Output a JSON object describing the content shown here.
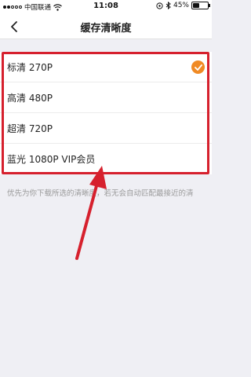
{
  "status_bar": {
    "carrier": "中国联通",
    "time": "11:08",
    "battery_text": "45%",
    "battery_level": 0.45
  },
  "nav": {
    "title": "缓存清晰度",
    "back_icon": "chevron-left-icon"
  },
  "options": [
    {
      "label": "标清 270P",
      "selected": true
    },
    {
      "label": "高清 480P",
      "selected": false
    },
    {
      "label": "超清 720P",
      "selected": false
    },
    {
      "label": "蓝光 1080P VIP会员",
      "selected": false
    }
  ],
  "hint": "优先为你下载所选的清晰度，若无会自动匹配最接近的清",
  "colors": {
    "accent": "#f08a24",
    "annotation": "#d6202d"
  }
}
